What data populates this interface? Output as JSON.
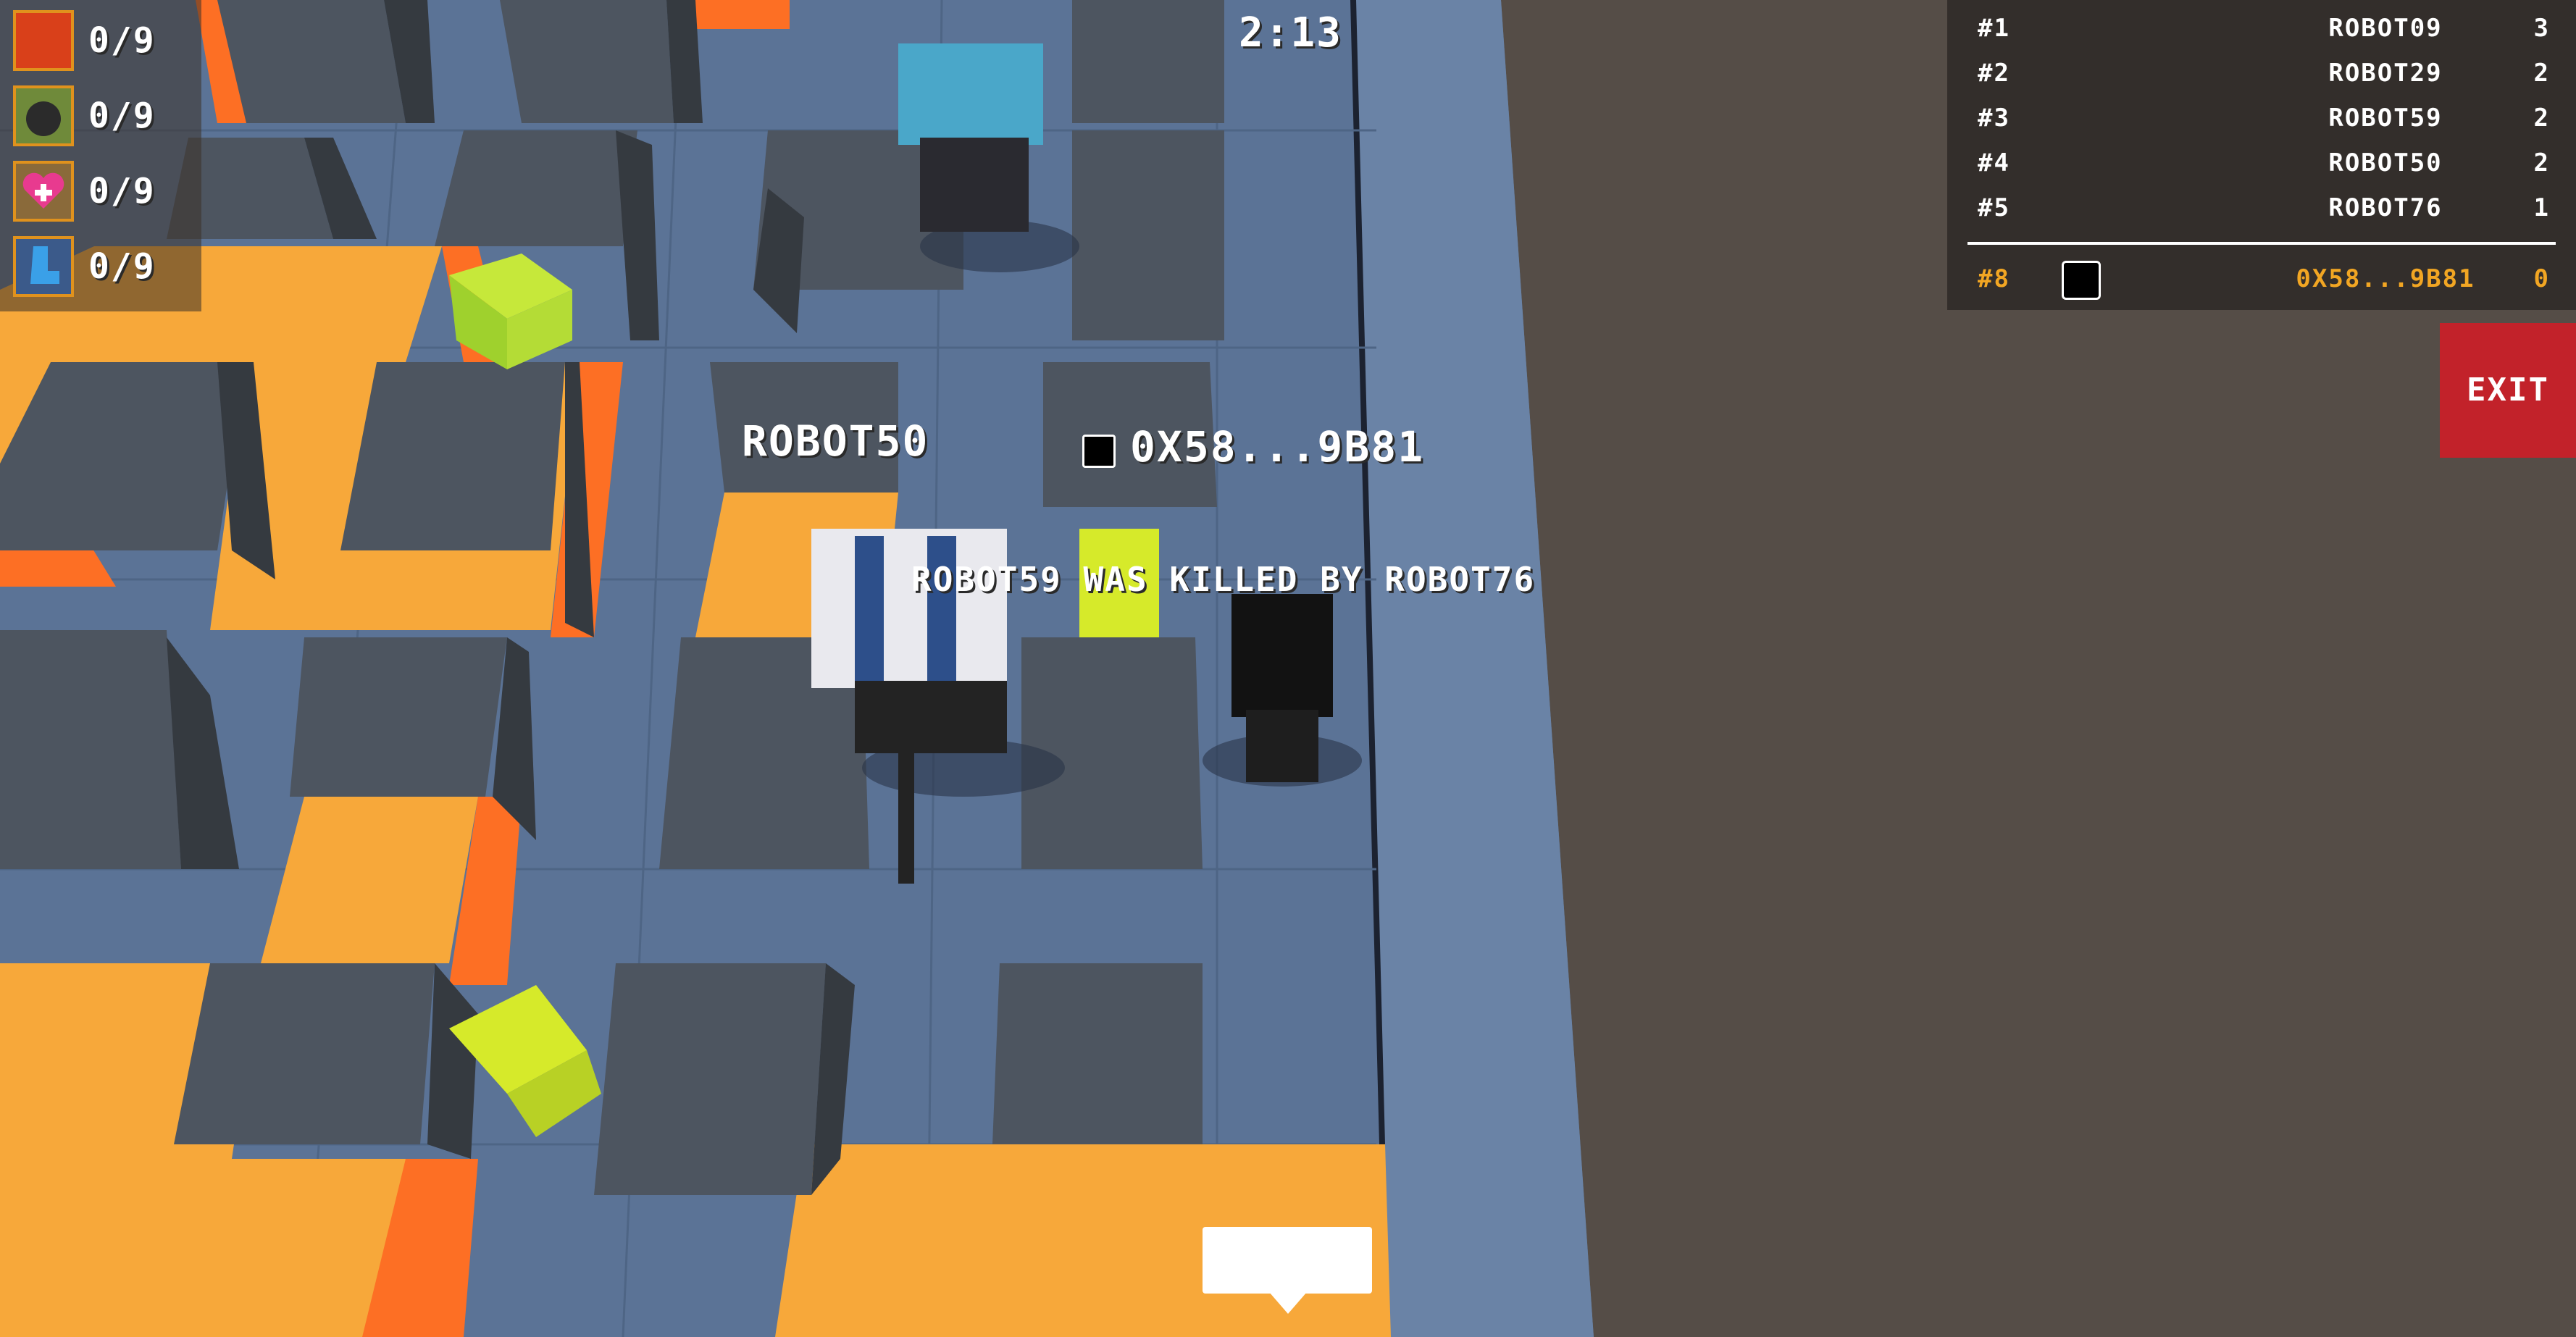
{
  "hud": {
    "timer": "2:13",
    "powerups": [
      {
        "icon": "fire-powerup-icon",
        "count": "0/9",
        "color": "#d9401a"
      },
      {
        "icon": "bomb-powerup-icon",
        "count": "0/9",
        "color": "#2b2b2b"
      },
      {
        "icon": "heart-powerup-icon",
        "count": "0/9",
        "color": "#e83a8f"
      },
      {
        "icon": "boot-powerup-icon",
        "count": "0/9",
        "color": "#3aa0e8"
      }
    ]
  },
  "leaderboard": {
    "rows": [
      {
        "rank": "#1",
        "name": "ROBOT09",
        "score": "3"
      },
      {
        "rank": "#2",
        "name": "ROBOT29",
        "score": "2"
      },
      {
        "rank": "#3",
        "name": "ROBOT59",
        "score": "2"
      },
      {
        "rank": "#4",
        "name": "ROBOT50",
        "score": "2"
      },
      {
        "rank": "#5",
        "name": "ROBOT76",
        "score": "1"
      }
    ],
    "self": {
      "rank": "#8",
      "name": "0X58...9B81",
      "score": "0"
    }
  },
  "exit_label": "EXIT",
  "labels": {
    "robot50": "ROBOT50",
    "self": "0X58...9B81"
  },
  "kill_feed": "ROBOT59 WAS KILLED BY ROBOT76",
  "colors": {
    "floor": "#5b7396",
    "orange": "#f7a83a",
    "orange_side": "#fd6f24",
    "block_top": "#4d5560",
    "block_side": "#353a40",
    "exit": "#c2222a",
    "self_highlight": "#f2a623"
  }
}
